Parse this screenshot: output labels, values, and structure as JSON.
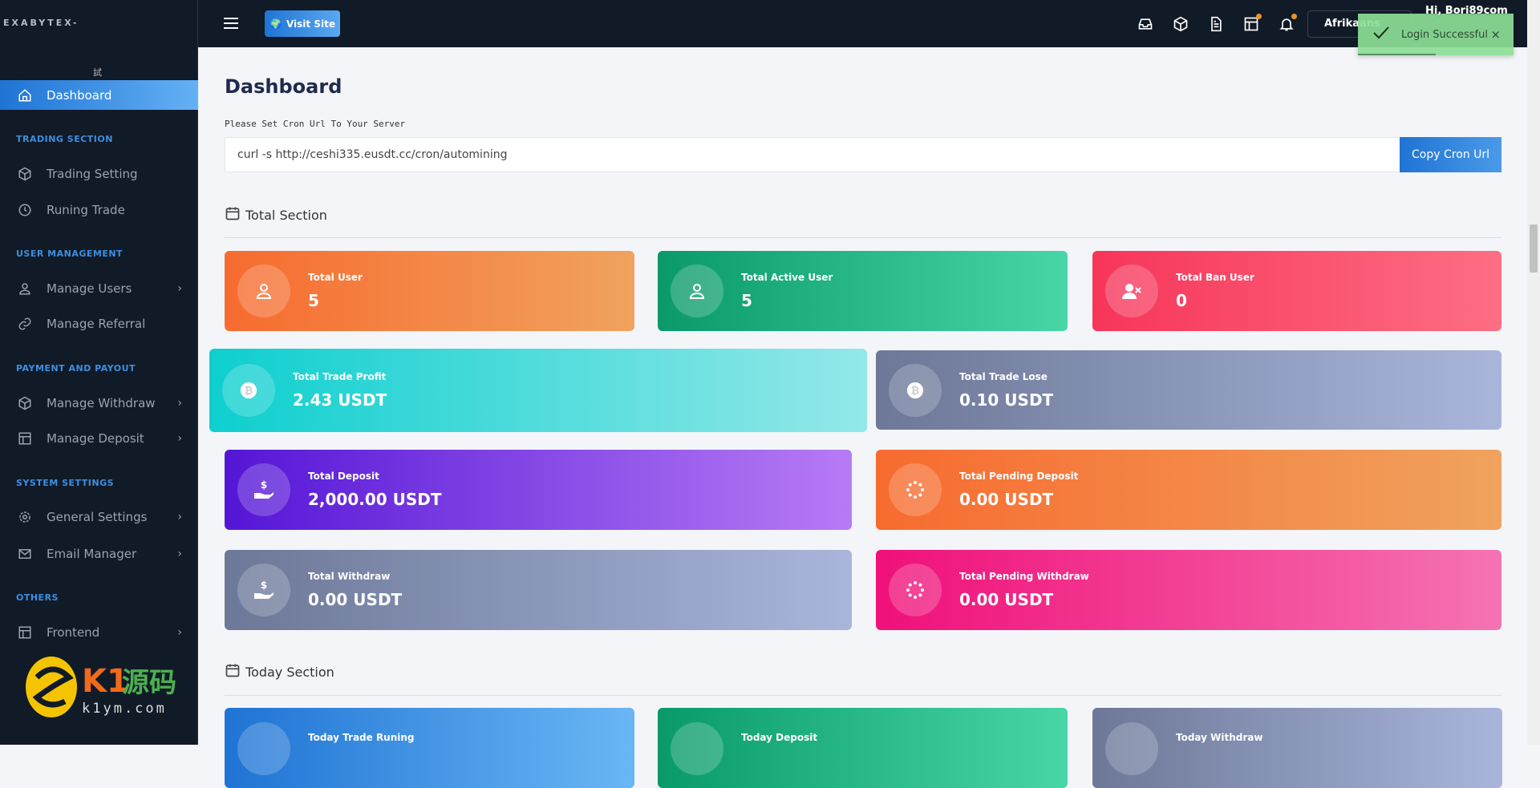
{
  "sidebar": {
    "brand": "EXABYTEX-",
    "glyph": "試",
    "active": "Dashboard",
    "sections": [
      {
        "title": "TRADING SECTION"
      },
      {
        "title": "USER MANAGEMENT"
      },
      {
        "title": "PAYMENT AND PAYOUT"
      },
      {
        "title": "SYSTEM SETTINGS"
      },
      {
        "title": "OTHERS"
      }
    ],
    "items": [
      {
        "label": "Trading Setting",
        "icon": "cube-icon"
      },
      {
        "label": "Runing Trade",
        "icon": "clock-icon"
      },
      {
        "label": "Manage Users",
        "icon": "user-icon"
      },
      {
        "label": "Manage Referral",
        "icon": "link-icon"
      },
      {
        "label": "Manage Withdraw",
        "icon": "cube-icon"
      },
      {
        "label": "Manage Deposit",
        "icon": "table-icon"
      },
      {
        "label": "General Settings",
        "icon": "gear-icon"
      },
      {
        "label": "Email Manager",
        "icon": "mail-icon"
      },
      {
        "label": "Frontend",
        "icon": "table-icon"
      }
    ],
    "watermark": {
      "text": "K1源码",
      "url": "k1ym.com"
    }
  },
  "topbar": {
    "visit_site": "Visit Site",
    "language": "Afrikaans",
    "user": "Hi, Bori89com",
    "icons": [
      "inbox-icon",
      "cube-icon",
      "document-icon",
      "table-icon",
      "bell-icon"
    ]
  },
  "toast": {
    "message": "Login Successful"
  },
  "main": {
    "title": "Dashboard",
    "cron_label": "Please Set Cron Url To Your Server",
    "cron_url": "curl -s http://ceshi335.eusdt.cc/cron/automining",
    "copy_button": "Copy Cron Url",
    "total_section": "Total Section",
    "today_section": "Today Section",
    "total_cards": [
      {
        "label": "Total User",
        "value": "5",
        "colors": [
          "#f76b2f",
          "#f0a35e"
        ]
      },
      {
        "label": "Total Active User",
        "value": "5",
        "colors": [
          "#0a9a6a",
          "#48d6a6"
        ]
      },
      {
        "label": "Total Ban User",
        "value": "0",
        "colors": [
          "#f7355a",
          "#fd6e84"
        ]
      },
      {
        "label": "Total Trade Profit",
        "value": "2.43 USDT",
        "colors": [
          "#0ecfcf",
          "#94e8e8"
        ]
      },
      {
        "label": "Total Trade Lose",
        "value": "0.10 USDT",
        "colors": [
          "#6d7898",
          "#a9b5da"
        ]
      },
      {
        "label": "Total Deposit",
        "value": "2,000.00 USDT",
        "colors": [
          "#5416d6",
          "#b77bf5"
        ]
      },
      {
        "label": "Total Pending Deposit",
        "value": "0.00 USDT",
        "colors": [
          "#f76b2f",
          "#f0a35e"
        ]
      },
      {
        "label": "Total Withdraw",
        "value": "0.00 USDT",
        "colors": [
          "#6d7898",
          "#a9b5da"
        ]
      },
      {
        "label": "Total Pending Withdraw",
        "value": "0.00 USDT",
        "colors": [
          "#f0107a",
          "#f573b2"
        ]
      }
    ],
    "today_cards": [
      {
        "label": "Today Trade Runing",
        "colors": [
          "#1f74d4",
          "#6ab6f5"
        ]
      },
      {
        "label": "Today Deposit",
        "colors": [
          "#0a9a6a",
          "#48d6a6"
        ]
      },
      {
        "label": "Today Withdraw",
        "colors": [
          "#6d7898",
          "#a9b5da"
        ]
      }
    ]
  }
}
